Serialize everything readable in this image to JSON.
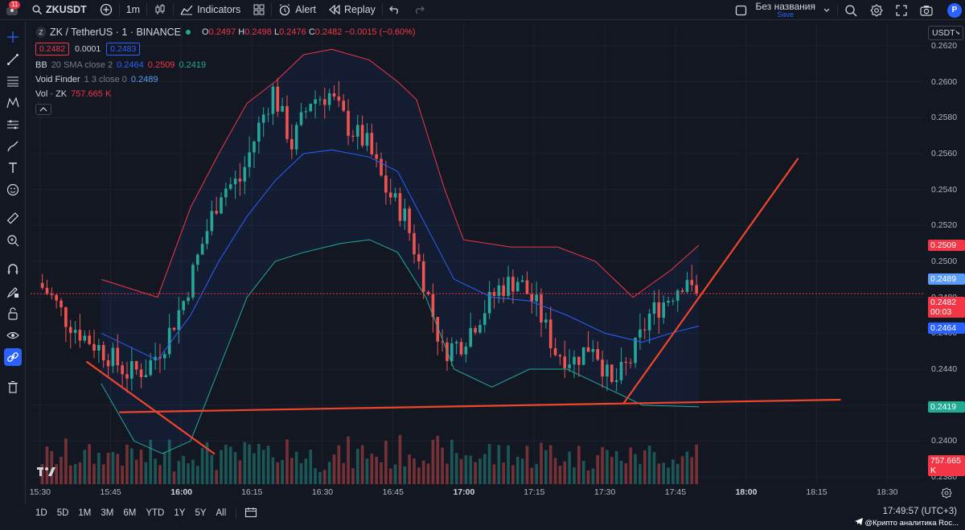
{
  "toolbar": {
    "avatar_badge": "11",
    "symbol": "ZKUSDT",
    "interval": "1m",
    "indicators_label": "Indicators",
    "alert_label": "Alert",
    "replay_label": "Replay",
    "layout_name": "Без названия",
    "save_label": "Save",
    "profile_initial": "P"
  },
  "legend": {
    "title": "ZK / TetherUS · 1 · BINANCE",
    "open": "0.2497",
    "high": "0.2498",
    "low": "0.2476",
    "close": "0.2482",
    "change": "−0.0015 (−0.60%)",
    "sell_price": "0.2482",
    "spread": "0.0001",
    "buy_price": "0.2483",
    "indicators": [
      {
        "name": "BB",
        "params": "20 SMA close 2",
        "values": [
          "0.2464",
          "0.2509",
          "0.2419"
        ],
        "colors": [
          "#2962ff",
          "#f23645",
          "#22ab94"
        ]
      },
      {
        "name": "Void Finder",
        "params": "1 3 close 0",
        "values": [
          "0.2489"
        ],
        "colors": [
          "#5b9cf6"
        ]
      },
      {
        "name": "Vol · ZK",
        "params": "",
        "values": [
          "757.665 K"
        ],
        "colors": [
          "#f23645"
        ]
      }
    ]
  },
  "price_axis": {
    "currency": "USDT",
    "ticks": [
      "0.2620",
      "0.2600",
      "0.2580",
      "0.2560",
      "0.2540",
      "0.2520",
      "0.2500",
      "0.2480",
      "0.2460",
      "0.2440",
      "0.2420",
      "0.2400",
      "0.2380"
    ],
    "labels": {
      "bb_upper": "0.2509",
      "void_finder": "0.2489",
      "last_price": "0.2482",
      "countdown": "00:03",
      "bb_basis": "0.2464",
      "bb_lower": "0.2419",
      "volume": "757.665 K"
    }
  },
  "time_axis": {
    "ticks": [
      {
        "label": "15:30",
        "bold": false
      },
      {
        "label": "15:45",
        "bold": false
      },
      {
        "label": "16:00",
        "bold": true
      },
      {
        "label": "16:15",
        "bold": false
      },
      {
        "label": "16:30",
        "bold": false
      },
      {
        "label": "16:45",
        "bold": false
      },
      {
        "label": "17:00",
        "bold": true
      },
      {
        "label": "17:15",
        "bold": false
      },
      {
        "label": "17:30",
        "bold": false
      },
      {
        "label": "17:45",
        "bold": false
      },
      {
        "label": "18:00",
        "bold": true
      },
      {
        "label": "18:15",
        "bold": false
      },
      {
        "label": "18:30",
        "bold": false
      }
    ]
  },
  "bottombar": {
    "ranges": [
      "1D",
      "5D",
      "1M",
      "3M",
      "6M",
      "YTD",
      "1Y",
      "5Y",
      "All"
    ],
    "clock": "17:49:57 (UTC+3)"
  },
  "watermark": "@Крипто аналитика Roc...",
  "colors": {
    "bg": "#131722",
    "up": "#26a69a",
    "down": "#ef5350",
    "bb_upper": "#f23645",
    "bb_basis": "#2962ff",
    "bb_lower": "#22ab94",
    "trendline": "#f0452b",
    "accent": "#2962ff"
  },
  "chart_data": {
    "type": "candlestick",
    "x_range": [
      "15:28",
      "18:38"
    ],
    "y_range": [
      0.2376,
      0.2632
    ],
    "current_price": 0.2482,
    "price_path": [
      [
        "15:30",
        0.2488
      ],
      [
        "15:33",
        0.248
      ],
      [
        "15:36",
        0.2468
      ],
      [
        "15:40",
        0.2458
      ],
      [
        "15:45",
        0.2448
      ],
      [
        "15:49",
        0.2438
      ],
      [
        "15:53",
        0.244
      ],
      [
        "15:57",
        0.2455
      ],
      [
        "16:01",
        0.2478
      ],
      [
        "16:05",
        0.251
      ],
      [
        "16:09",
        0.254
      ],
      [
        "16:13",
        0.2545
      ],
      [
        "16:17",
        0.2575
      ],
      [
        "16:20",
        0.2595
      ],
      [
        "16:24",
        0.2565
      ],
      [
        "16:28",
        0.259
      ],
      [
        "16:32",
        0.2593
      ],
      [
        "16:36",
        0.2575
      ],
      [
        "16:40",
        0.2565
      ],
      [
        "16:44",
        0.254
      ],
      [
        "16:48",
        0.2525
      ],
      [
        "16:52",
        0.249
      ],
      [
        "16:56",
        0.245
      ],
      [
        "17:00",
        0.2455
      ],
      [
        "17:04",
        0.247
      ],
      [
        "17:08",
        0.2485
      ],
      [
        "17:12",
        0.249
      ],
      [
        "17:16",
        0.2475
      ],
      [
        "17:20",
        0.245
      ],
      [
        "17:24",
        0.2445
      ],
      [
        "17:28",
        0.2455
      ],
      [
        "17:32",
        0.243
      ],
      [
        "17:36",
        0.2445
      ],
      [
        "17:40",
        0.247
      ],
      [
        "17:44",
        0.248
      ],
      [
        "17:48",
        0.2492
      ],
      [
        "17:49",
        0.2482
      ]
    ],
    "bb_upper": [
      [
        "15:43",
        0.249
      ],
      [
        "15:55",
        0.248
      ],
      [
        "16:02",
        0.253
      ],
      [
        "16:08",
        0.256
      ],
      [
        "16:14",
        0.2588
      ],
      [
        "16:20",
        0.26
      ],
      [
        "16:26",
        0.2615
      ],
      [
        "16:32",
        0.2618
      ],
      [
        "16:40",
        0.2612
      ],
      [
        "16:46",
        0.26
      ],
      [
        "16:50",
        0.259
      ],
      [
        "16:56",
        0.254
      ],
      [
        "17:00",
        0.2512
      ],
      [
        "17:10",
        0.2508
      ],
      [
        "17:20",
        0.2508
      ],
      [
        "17:28",
        0.25
      ],
      [
        "17:36",
        0.248
      ],
      [
        "17:44",
        0.2495
      ],
      [
        "17:50",
        0.2509
      ]
    ],
    "bb_basis": [
      [
        "15:43",
        0.246
      ],
      [
        "15:55",
        0.2445
      ],
      [
        "16:02",
        0.247
      ],
      [
        "16:08",
        0.25
      ],
      [
        "16:14",
        0.2525
      ],
      [
        "16:20",
        0.2545
      ],
      [
        "16:26",
        0.256
      ],
      [
        "16:32",
        0.2562
      ],
      [
        "16:40",
        0.2558
      ],
      [
        "16:46",
        0.255
      ],
      [
        "16:52",
        0.252
      ],
      [
        "16:58",
        0.249
      ],
      [
        "17:06",
        0.248
      ],
      [
        "17:14",
        0.2478
      ],
      [
        "17:22",
        0.247
      ],
      [
        "17:30",
        0.246
      ],
      [
        "17:38",
        0.2455
      ],
      [
        "17:44",
        0.246
      ],
      [
        "17:50",
        0.2464
      ]
    ],
    "bb_lower": [
      [
        "15:43",
        0.2432
      ],
      [
        "15:50",
        0.24
      ],
      [
        "15:56",
        0.2393
      ],
      [
        "16:02",
        0.24
      ],
      [
        "16:08",
        0.244
      ],
      [
        "16:14",
        0.248
      ],
      [
        "16:20",
        0.25
      ],
      [
        "16:26",
        0.2505
      ],
      [
        "16:34",
        0.251
      ],
      [
        "16:40",
        0.2512
      ],
      [
        "16:46",
        0.2505
      ],
      [
        "16:52",
        0.248
      ],
      [
        "16:58",
        0.244
      ],
      [
        "17:06",
        0.243
      ],
      [
        "17:14",
        0.244
      ],
      [
        "17:22",
        0.244
      ],
      [
        "17:30",
        0.243
      ],
      [
        "17:38",
        0.242
      ],
      [
        "17:50",
        0.2419
      ]
    ],
    "trendlines": [
      {
        "from": [
          "15:40",
          0.2444
        ],
        "to": [
          "16:07",
          0.2393
        ]
      },
      {
        "from": [
          "15:47",
          0.2416
        ],
        "to": [
          "18:20",
          0.2423
        ]
      },
      {
        "from": [
          "17:34",
          0.2421
        ],
        "to": [
          "18:11",
          0.2557
        ]
      }
    ]
  }
}
